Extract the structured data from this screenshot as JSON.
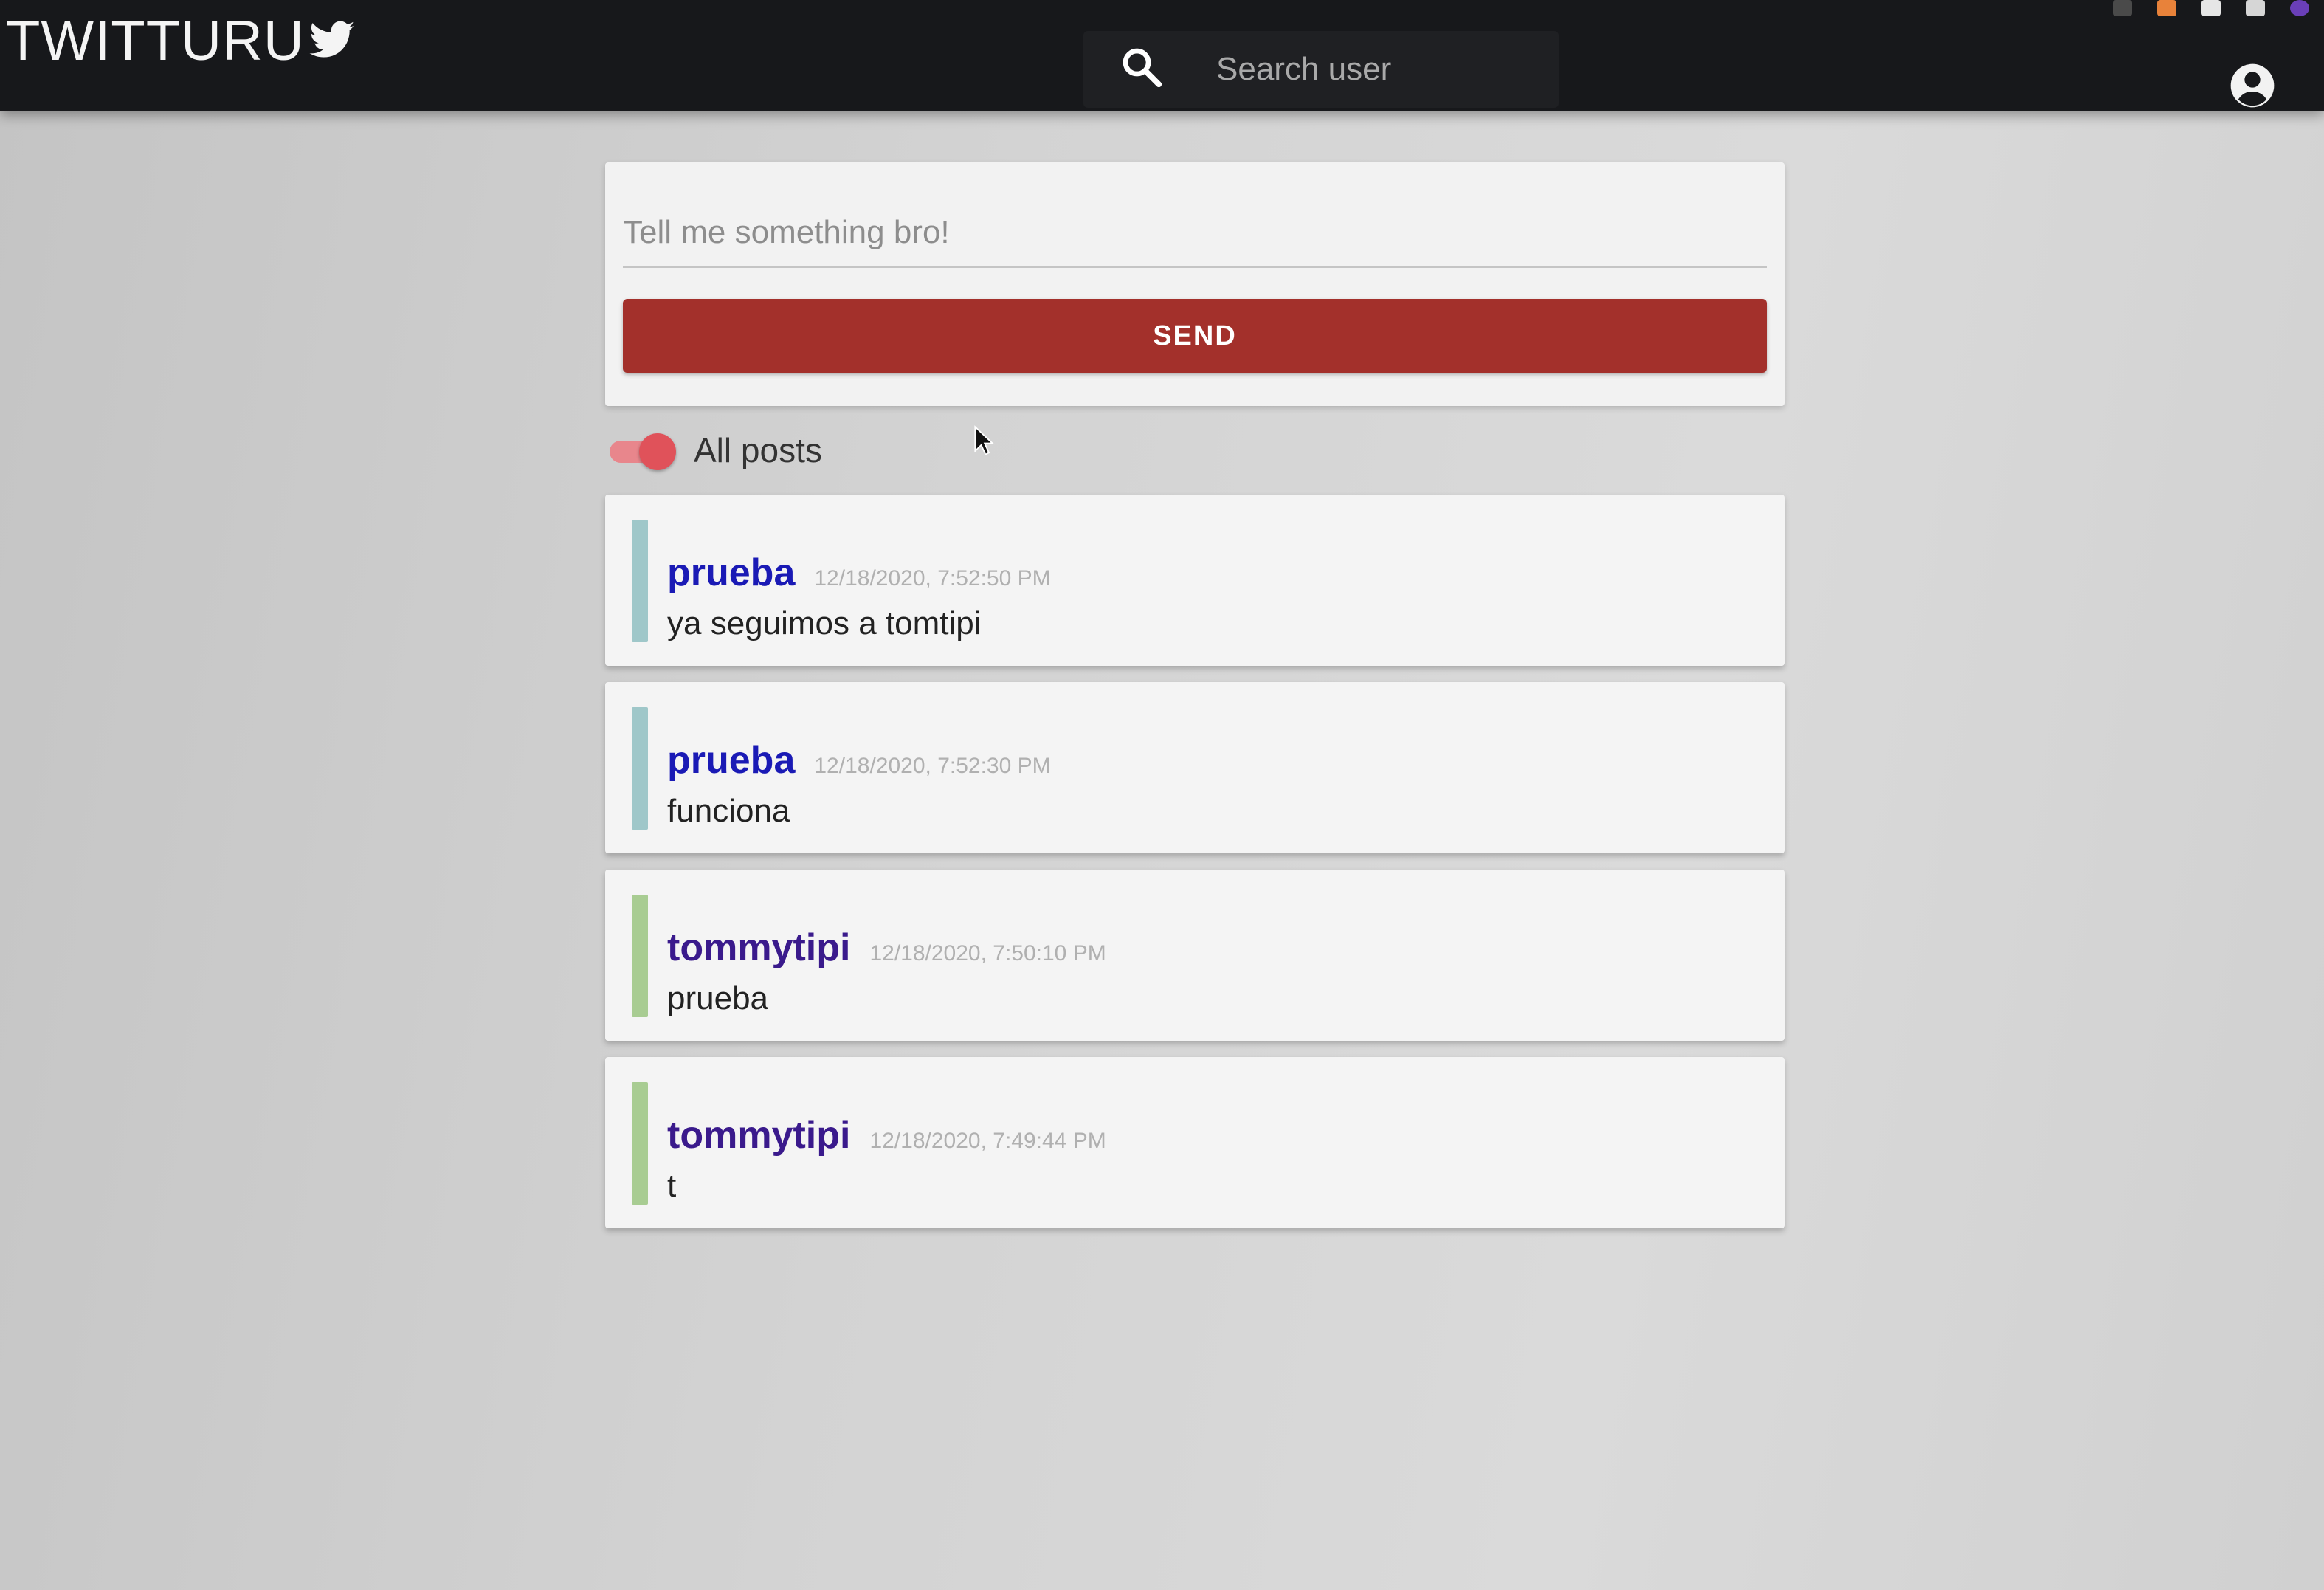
{
  "header": {
    "app_title": "TWITTURU",
    "logo_icon": "twitter-bird-icon",
    "search": {
      "placeholder": "Search user",
      "value": "",
      "icon": "search-icon"
    },
    "account_icon": "account-circle-icon",
    "background_color": "#17181b"
  },
  "compose": {
    "placeholder": "Tell me something bro!",
    "value": "",
    "send_label": "SEND",
    "send_color": "#a3302b"
  },
  "filter": {
    "label": "All posts",
    "toggle_on": true,
    "toggle_color": "#e0525a"
  },
  "posts": [
    {
      "user": "prueba",
      "timestamp": "12/18/2020, 7:52:50 PM",
      "text": "ya seguimos a tomtipi",
      "user_color": "#1a1ab5",
      "bar_color": "#9fc7c9"
    },
    {
      "user": "prueba",
      "timestamp": "12/18/2020, 7:52:30 PM",
      "text": "funciona",
      "user_color": "#1a1ab5",
      "bar_color": "#9fc7c9"
    },
    {
      "user": "tommytipi",
      "timestamp": "12/18/2020, 7:50:10 PM",
      "text": "prueba",
      "user_color": "#3a1a8c",
      "bar_color": "#a8cc92"
    },
    {
      "user": "tommytipi",
      "timestamp": "12/18/2020, 7:49:44 PM",
      "text": "t",
      "user_color": "#3a1a8c",
      "bar_color": "#a8cc92"
    }
  ]
}
